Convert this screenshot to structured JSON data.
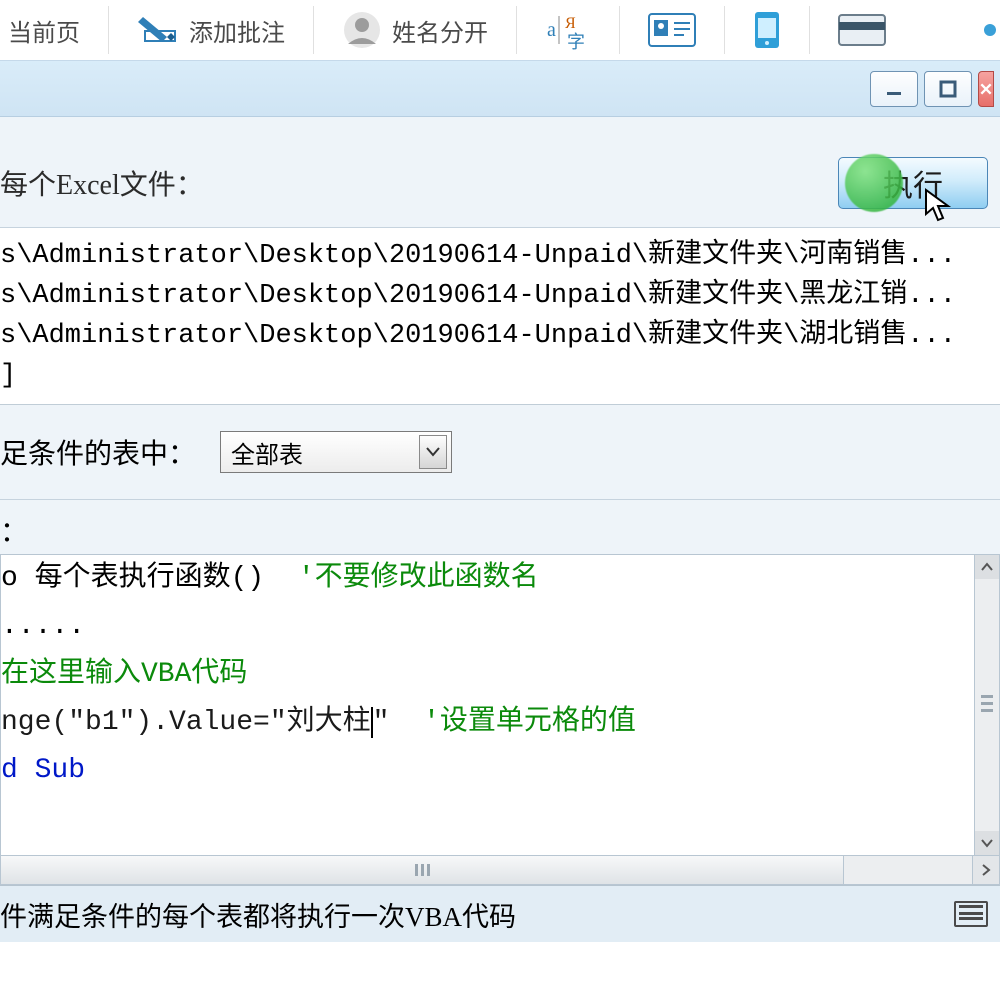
{
  "ribbon": {
    "prev_page": "当前页",
    "annotate": "添加批注",
    "split_name": "姓名分开"
  },
  "section": {
    "every_excel": "每个Excel文件：",
    "run_label": "执行"
  },
  "files": [
    "s\\Administrator\\Desktop\\20190614-Unpaid\\新建文件夹\\河南销售...",
    "s\\Administrator\\Desktop\\20190614-Unpaid\\新建文件夹\\黑龙江销...",
    "s\\Administrator\\Desktop\\20190614-Unpaid\\新建文件夹\\湖北销售..."
  ],
  "condition": {
    "label": "足条件的表中：",
    "select_value": "全部表"
  },
  "colon": "：",
  "code": {
    "l1a": "o 每个表执行函数()  ",
    "l1b": "'不要修改此函数名",
    "l2": ".....",
    "l3": "在这里输入VBA代码",
    "l4a": "nge(\"b1\").Value=\"刘大柱",
    "l4b": "\"  ",
    "l4c": "'设置单元格的值",
    "l5a": "d ",
    "l5b": "Sub"
  },
  "status": {
    "text": "件满足条件的每个表都将执行一次VBA代码"
  }
}
